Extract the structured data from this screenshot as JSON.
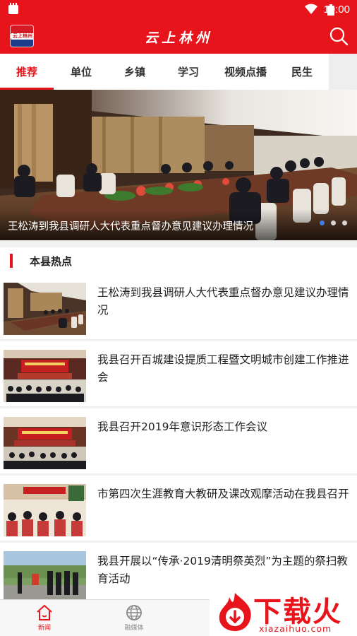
{
  "status_bar": {
    "time": "10:00"
  },
  "app_bar": {
    "logo_text": "云上林州",
    "title": "云上林州"
  },
  "tabs": [
    {
      "label": "推荐",
      "active": true
    },
    {
      "label": "单位"
    },
    {
      "label": "乡镇"
    },
    {
      "label": "学习"
    },
    {
      "label": "视频点播"
    },
    {
      "label": "民生"
    }
  ],
  "banner": {
    "caption": "王松涛到我县调研人大代表重点督办意见建议办理情况",
    "slide_count": 3,
    "active_slide": 1
  },
  "section": {
    "title": "本县热点"
  },
  "news": [
    {
      "title": "王松涛到我县调研人大代表重点督办意见建议办理情况",
      "thumb": "meeting-table"
    },
    {
      "title": "我县召开百城建设提质工程暨文明城市创建工作推进会",
      "thumb": "auditorium"
    },
    {
      "title": "我县召开2019年意识形态工作会议",
      "thumb": "auditorium"
    },
    {
      "title": "市第四次生涯教育大教研及课改观摩活动在我县召开",
      "thumb": "classroom"
    },
    {
      "title": "我县开展以“传承·2019清明祭英烈”为主题的祭扫教育活动",
      "thumb": "outdoor"
    }
  ],
  "bottom_nav": [
    {
      "label": "新闻",
      "icon": "home-icon",
      "active": true
    },
    {
      "label": "融媒体",
      "icon": "globe-icon"
    }
  ],
  "watermark": {
    "text": "下载火",
    "url": "xiazaihuo.com"
  },
  "colors": {
    "brand_red": "#e8141c",
    "dot_active": "#3b7de0"
  }
}
